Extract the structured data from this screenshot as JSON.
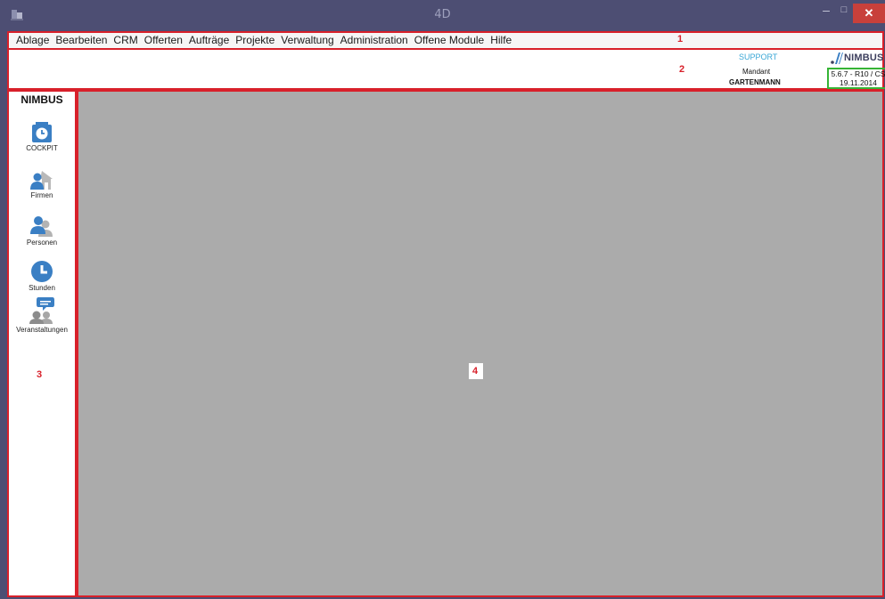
{
  "window": {
    "title": "4D",
    "icon": "4d-app-icon",
    "controls": {
      "minimize": "–",
      "maximize": "□",
      "close": "✕"
    }
  },
  "menu": {
    "items": [
      "Ablage",
      "Bearbeiten",
      "CRM",
      "Offerten",
      "Aufträge",
      "Projekte",
      "Verwaltung",
      "Administration",
      "Offene Module",
      "Hilfe"
    ],
    "marker": "1"
  },
  "header": {
    "marker": "2",
    "support": "SUPPORT",
    "mandant_label": "Mandant",
    "mandant_name": "GARTENMANN",
    "logo_text": "NIMBUS",
    "version": "5.6.7 - R10 / CS",
    "date": "19.11.2014"
  },
  "sidebar": {
    "title": "NIMBUS",
    "marker": "3",
    "items": [
      {
        "label": "COCKPIT",
        "icon": "cockpit-clock-icon"
      },
      {
        "label": "Firmen",
        "icon": "company-house-icon"
      },
      {
        "label": "Personen",
        "icon": "persons-icon"
      },
      {
        "label": "Stunden",
        "icon": "clock-icon"
      },
      {
        "label": "Veranstaltungen",
        "icon": "event-speech-icon"
      }
    ]
  },
  "main": {
    "marker": "4"
  },
  "colors": {
    "titlebar": "#4d4e73",
    "highlight_border": "#d8202a",
    "version_border": "#36b435",
    "workspace": "#ababab",
    "icon_blue": "#3a7fc4"
  }
}
